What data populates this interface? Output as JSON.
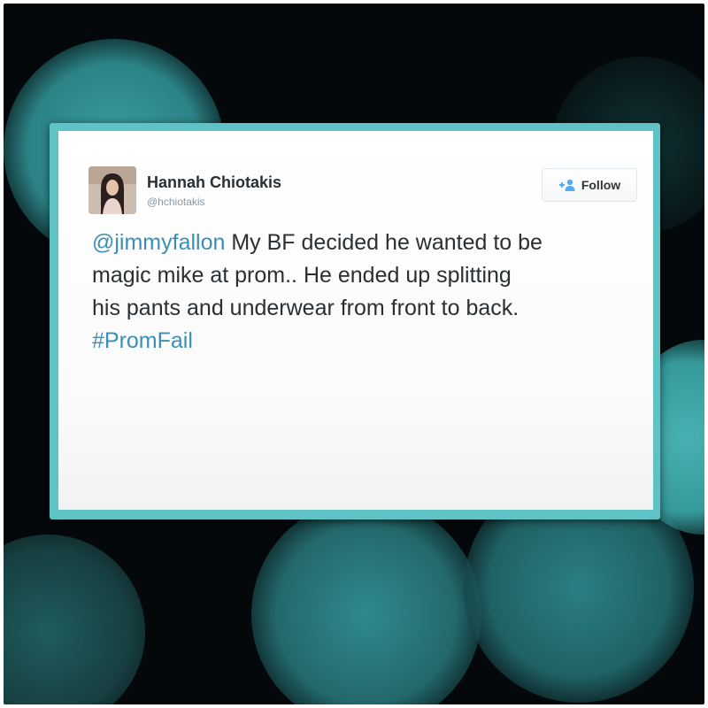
{
  "tweet": {
    "author": {
      "name": "Hannah Chiotakis",
      "handle": "@hchiotakis"
    },
    "follow_button": {
      "label": "Follow",
      "icon": "add-user-icon"
    },
    "text": {
      "mention": "@jimmyfallon",
      "line1": " My BF decided he wanted to be",
      "line2": "magic mike at prom.. He ended up splitting",
      "line3": "his pants and underwear from front to back.",
      "hashtag": "#PromFail"
    }
  },
  "colors": {
    "card_border": "#5fc2c4",
    "link": "#3b8fb7",
    "background": "#05080a",
    "bokeh": "#3a9ea0"
  }
}
